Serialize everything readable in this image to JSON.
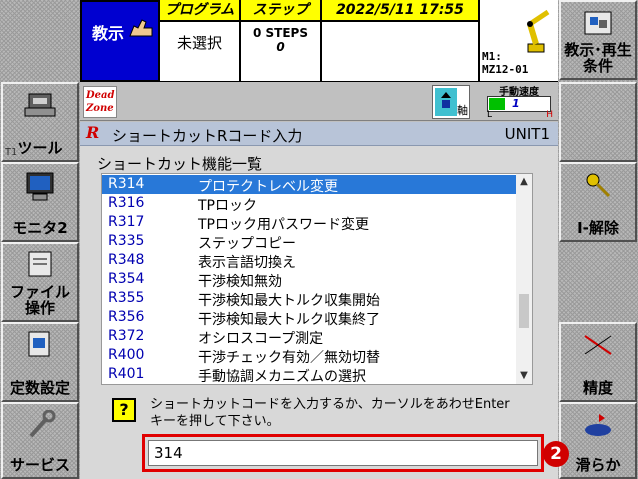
{
  "header": {
    "mode_label": "教示",
    "program_header": "プログラム",
    "program_value": "未選択",
    "step_header": "ステップ",
    "step_value": "0 STEPS",
    "step_sub": "0",
    "datetime": "2022/5/11  17:55",
    "robot_id": "M1:\nMZ12-01"
  },
  "status": {
    "dead_zone_line1": "Dead",
    "dead_zone_line2": "Zone",
    "axis_label": "軸",
    "speed_title": "手動速度",
    "speed_value": "1",
    "speed_low": "L",
    "speed_high": "H",
    "speed_level": 0.25
  },
  "left_buttons": [
    {
      "label": "ツール",
      "sub": "T1"
    },
    {
      "label": "モニタ2"
    },
    {
      "label": "ファイル\n操作"
    },
    {
      "label": "定数設定"
    },
    {
      "label": "サービス"
    }
  ],
  "right_buttons": [
    {
      "label": "教示･再生\n条件"
    },
    {
      "label": ""
    },
    {
      "label": "I-解除"
    },
    {
      "label": "精度"
    },
    {
      "label": "滑らか"
    }
  ],
  "dialog": {
    "title_icon": "R",
    "title": "ショートカットRコード入力",
    "unit": "UNIT1",
    "list_label": "ショートカット機能一覧",
    "items": [
      {
        "code": "R314",
        "name": "プロテクトレベル変更",
        "selected": true
      },
      {
        "code": "R316",
        "name": "TPロック"
      },
      {
        "code": "R317",
        "name": "TPロック用パスワード変更"
      },
      {
        "code": "R335",
        "name": "ステップコピー"
      },
      {
        "code": "R348",
        "name": "表示言語切換え"
      },
      {
        "code": "R354",
        "name": "干渉検知無効"
      },
      {
        "code": "R355",
        "name": "干渉検知最大トルク収集開始"
      },
      {
        "code": "R356",
        "name": "干渉検知最大トルク収集終了"
      },
      {
        "code": "R372",
        "name": "オシロスコープ測定"
      },
      {
        "code": "R400",
        "name": "干渉チェック有効／無効切替"
      },
      {
        "code": "R401",
        "name": "手動協調メカニズムの選択"
      }
    ],
    "help_glyph": "?",
    "prompt_line1": "ショートカットコードを入力するか、カーソルをあわせEnter",
    "prompt_line2": "キーを押して下さい。",
    "input_value": "314",
    "step_badge": "2"
  },
  "colors": {
    "mode_bg": "#0000d0",
    "header_yellow": "#ffff00",
    "selection": "#2878d8",
    "highlight_red": "#e00000"
  }
}
